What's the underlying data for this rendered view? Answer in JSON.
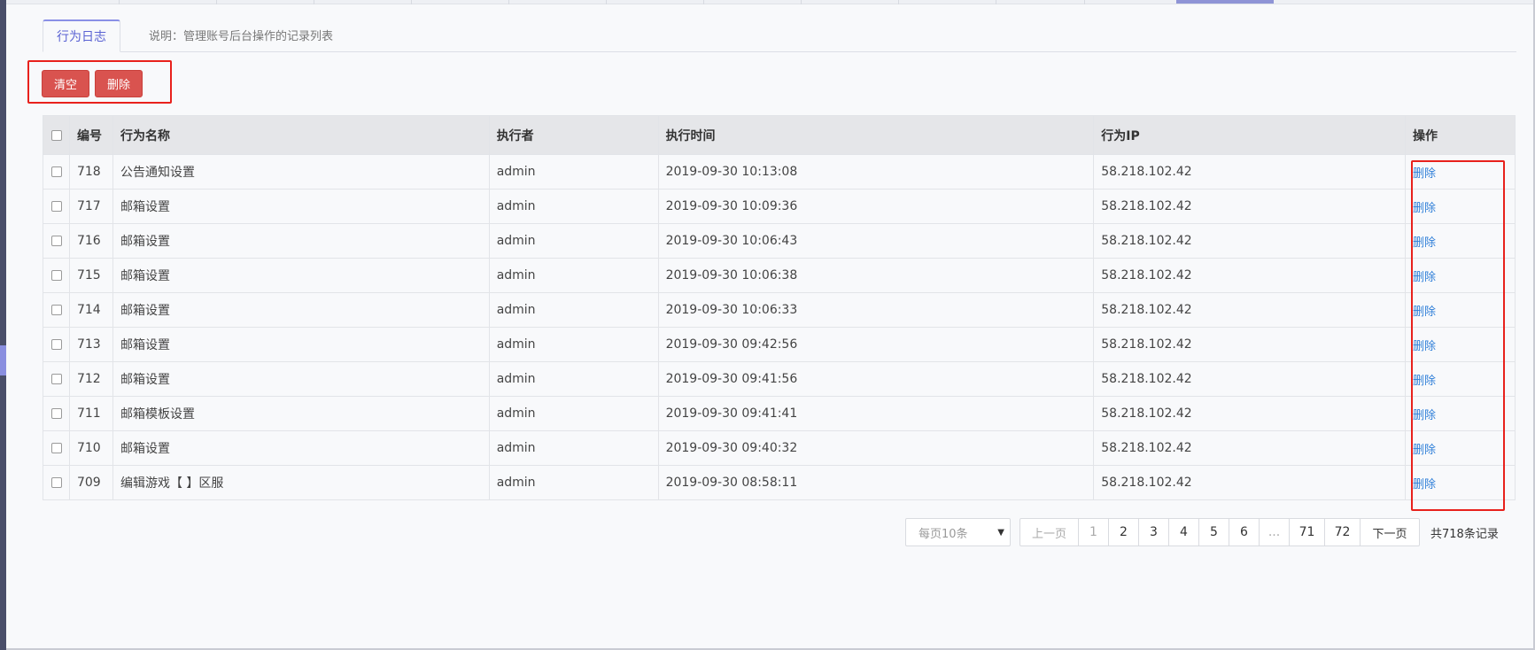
{
  "tabs": {
    "active_label": "行为日志",
    "note": "说明：管理账号后台操作的记录列表"
  },
  "toolbar": {
    "clear_label": "清空",
    "delete_label": "删除"
  },
  "table": {
    "headers": {
      "id": "编号",
      "name": "行为名称",
      "user": "执行者",
      "time": "执行时间",
      "ip": "行为IP",
      "op": "操作"
    },
    "rows": [
      {
        "id": "718",
        "name": "公告通知设置",
        "user": "admin",
        "time": "2019-09-30 10:13:08",
        "ip": "58.218.102.42",
        "op": "删除"
      },
      {
        "id": "717",
        "name": "邮箱设置",
        "user": "admin",
        "time": "2019-09-30 10:09:36",
        "ip": "58.218.102.42",
        "op": "删除"
      },
      {
        "id": "716",
        "name": "邮箱设置",
        "user": "admin",
        "time": "2019-09-30 10:06:43",
        "ip": "58.218.102.42",
        "op": "删除"
      },
      {
        "id": "715",
        "name": "邮箱设置",
        "user": "admin",
        "time": "2019-09-30 10:06:38",
        "ip": "58.218.102.42",
        "op": "删除"
      },
      {
        "id": "714",
        "name": "邮箱设置",
        "user": "admin",
        "time": "2019-09-30 10:06:33",
        "ip": "58.218.102.42",
        "op": "删除"
      },
      {
        "id": "713",
        "name": "邮箱设置",
        "user": "admin",
        "time": "2019-09-30 09:42:56",
        "ip": "58.218.102.42",
        "op": "删除"
      },
      {
        "id": "712",
        "name": "邮箱设置",
        "user": "admin",
        "time": "2019-09-30 09:41:56",
        "ip": "58.218.102.42",
        "op": "删除"
      },
      {
        "id": "711",
        "name": "邮箱模板设置",
        "user": "admin",
        "time": "2019-09-30 09:41:41",
        "ip": "58.218.102.42",
        "op": "删除"
      },
      {
        "id": "710",
        "name": "邮箱设置",
        "user": "admin",
        "time": "2019-09-30 09:40:32",
        "ip": "58.218.102.42",
        "op": "删除"
      },
      {
        "id": "709",
        "name": "编辑游戏【 】区服",
        "user": "admin",
        "time": "2019-09-30 08:58:11",
        "ip": "58.218.102.42",
        "op": "删除"
      }
    ]
  },
  "pagination": {
    "page_size": "每页10条",
    "prev": "上一页",
    "pages": [
      "1",
      "2",
      "3",
      "4",
      "5",
      "6",
      "...",
      "71",
      "72"
    ],
    "next": "下一页",
    "total": "共718条记录"
  },
  "colors": {
    "accent": "#5b63d3",
    "danger": "#d9534f",
    "link": "#2f7fd8",
    "highlight": "#e8211c"
  }
}
